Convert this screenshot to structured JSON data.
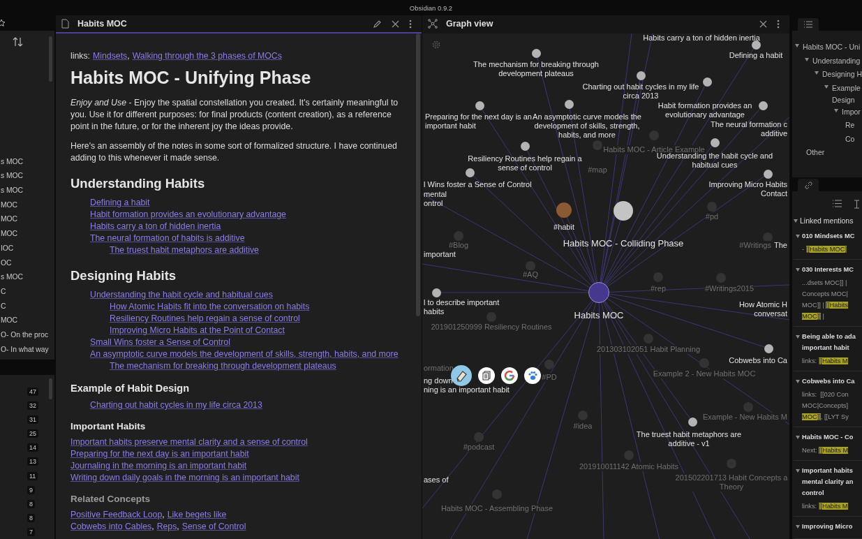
{
  "app_title": "Obsidian 0.9.2",
  "left": {
    "files": [
      "s MOC",
      "s MOC",
      "s MOC",
      "MOC",
      "MOC",
      "MOC",
      "IOC",
      "OC",
      "s MOC",
      "C",
      "C",
      "MOC",
      "O- On the proc",
      "O- In what way"
    ],
    "tag_counts": [
      "47",
      "32",
      "31",
      "25",
      "14",
      "13",
      "11",
      "9",
      "8",
      "8",
      "7"
    ]
  },
  "editor": {
    "tab_title": "Habits MOC",
    "links_label": "links:",
    "links": [
      "Mindsets",
      "Walking through the 3 phases of MOCs"
    ],
    "separator": ",",
    "title": "Habits MOC - Unifying Phase",
    "paragraphs": [
      "*Enjoy and Use* - Enjoy the spatial constellation you created. It's certainly meaningful to you. Use it for different purposes: for final products (content creation), as a reference point in the future, or for the inherent joy the ideas provide.",
      "Here's an assembly of the notes in some sort of formalized structure. I have continued adding to this whenever it made sense."
    ],
    "sections": [
      {
        "heading": "Understanding Habits",
        "kind": "h2",
        "items": [
          {
            "text": "Defining a habit"
          },
          {
            "text": "Habit formation provides an evolutionary advantage"
          },
          {
            "text": "Habits carry a ton of hidden inertia"
          },
          {
            "text": "The neural formation of habits is additive",
            "children": [
              {
                "text": "The truest habit metaphors are additive"
              }
            ]
          }
        ]
      },
      {
        "heading": "Designing Habits",
        "kind": "h2",
        "items": [
          {
            "text": "Understanding the habit cycle and habitual cues",
            "children": [
              {
                "text": "How Atomic Habits fit into the conversation on habits"
              },
              {
                "text": "Resiliency Routines help regain a sense of control"
              },
              {
                "text": "Improving Micro Habits at the Point of Contact"
              }
            ]
          },
          {
            "text": "Small Wins foster a Sense of Control"
          },
          {
            "text": "An asymptotic curve models the development of skills, strength, habits, and more",
            "children": [
              {
                "text": "The mechanism for breaking through development plateaus"
              }
            ]
          }
        ]
      },
      {
        "heading": "Example of Habit Design",
        "kind": "h3",
        "items": [
          {
            "text": "Charting out habit cycles in my life circa 2013"
          }
        ]
      },
      {
        "heading": "Important Habits",
        "kind": "h4",
        "lines": [
          "Important habits preserve mental clarity and a sense of control",
          "Preparing for the next day is an important habit",
          "Journaling in the morning is an important habit",
          "Writing down daily goals in the morning is an important habit"
        ]
      },
      {
        "heading": "Related Concepts",
        "kind": "h4-dim",
        "link_rows": [
          [
            "Positive Feedback Loop",
            "Like begets like"
          ],
          [
            "Cobwebs into Cables",
            "Reps",
            "Sense of Control"
          ]
        ]
      }
    ]
  },
  "graph": {
    "tab_title": "Graph view",
    "nodes": [
      {
        "label": "Habits carry a ton of hidden inertia",
        "kind": "text"
      },
      {
        "label": "Defining a habit",
        "kind": "note"
      },
      {
        "label": "The mechanism for breaking through\ndevelopment plateaus",
        "kind": "note"
      },
      {
        "label": "Charting out habit cycles in my life\ncirca 2013",
        "kind": "note"
      },
      {
        "label": "Habit formation provides an\nevolutionary advantage",
        "kind": "note"
      },
      {
        "label": "Preparing for the next day is an\nimportant habit",
        "kind": "note"
      },
      {
        "label": "An asymptotic curve models the\ndevelopment of skills, strength,\nhabits, and more",
        "kind": "note"
      },
      {
        "label": "The neural formation c\nadditive",
        "kind": "note"
      },
      {
        "label": "Habits MOC - Article Example",
        "kind": "faded"
      },
      {
        "label": "Resiliency Routines help regain a\nsense of control",
        "kind": "note"
      },
      {
        "label": "Understanding the habit cycle and\nhabitual cues",
        "kind": "note"
      },
      {
        "label": "#map",
        "kind": "faded"
      },
      {
        "label": "l Wins foster a Sense of Control",
        "kind": "note"
      },
      {
        "label": "mental\nontrol",
        "kind": "text"
      },
      {
        "label": "Improving Micro Habits\nContact",
        "kind": "note"
      },
      {
        "label": "#pd",
        "kind": "faded"
      },
      {
        "label": "#habit",
        "kind": "tag"
      },
      {
        "label": "#Blog",
        "kind": "faded"
      },
      {
        "label": "Habits MOC - Colliding Phase",
        "kind": "hub"
      },
      {
        "label": "important",
        "kind": "text"
      },
      {
        "label": "#Writings",
        "kind": "faded"
      },
      {
        "label": "The",
        "kind": "text"
      },
      {
        "label": "#AQ",
        "kind": "faded"
      },
      {
        "label": "Habits MOC",
        "kind": "center"
      },
      {
        "label": "l to describe important\nhabits",
        "kind": "note"
      },
      {
        "label": "#rep",
        "kind": "faded"
      },
      {
        "label": "#Writings2015",
        "kind": "faded"
      },
      {
        "label": "How Atomic H\nconversat",
        "kind": "text"
      },
      {
        "label": "201901250999 Resiliency Routines",
        "kind": "faded"
      },
      {
        "label": "201303102051 Habit Planning",
        "kind": "faded"
      },
      {
        "label": "Cobwebs into Ca",
        "kind": "note"
      },
      {
        "label": "Example 2 - New Habits MOC",
        "kind": "faded"
      },
      {
        "label": "ormation",
        "kind": "faded"
      },
      {
        "label": "ng down",
        "kind": "text"
      },
      {
        "label": "ning is an important habit",
        "kind": "text"
      },
      {
        "label": "#PD",
        "kind": "faded"
      },
      {
        "label": "#idea",
        "kind": "faded"
      },
      {
        "label": "The truest habit metaphors are\nadditive - v1",
        "kind": "note"
      },
      {
        "label": "Example - New Habits M",
        "kind": "faded"
      },
      {
        "label": "#podcast",
        "kind": "faded"
      },
      {
        "label": "201910011142 Atomic Habits",
        "kind": "faded"
      },
      {
        "label": "ases of",
        "kind": "text"
      },
      {
        "label": "201502201713 Habit Concepts a\nTheory",
        "kind": "faded"
      },
      {
        "label": "Habits MOC - Assembling Phase",
        "kind": "faded"
      }
    ]
  },
  "outline": [
    {
      "label": "Habits MOC - Uni",
      "expanded": true,
      "children": [
        {
          "label": "Understanding",
          "expanded": true,
          "children": [
            {
              "label": "Designing H",
              "expanded": true,
              "children": [
                {
                  "label": "Example\nDesign",
                  "expanded": true,
                  "children": [
                    {
                      "label": "Impor",
                      "expanded": true,
                      "children": [
                        {
                          "label": "Re"
                        },
                        {
                          "label": "Co"
                        }
                      ]
                    }
                  ]
                }
              ]
            }
          ]
        },
        {
          "label": "Other"
        }
      ]
    }
  ],
  "backlinks": {
    "title": "Linked mentions",
    "expanded": true,
    "groups": [
      {
        "title": "010 Mindsets MC",
        "expanded": true,
        "lines": [
          [
            {
              "text": "- ",
              "highlight": false
            },
            {
              "text": "[[Habits MOC]",
              "highlight": true
            }
          ]
        ]
      },
      {
        "title": "030 Interests MC",
        "expanded": true,
        "lines": [
          [
            {
              "text": "...dsets MOC]] |",
              "highlight": false
            }
          ],
          [
            {
              "text": "Concepts MOC|",
              "highlight": false
            }
          ],
          [
            {
              "text": "MOC]] | ",
              "highlight": false
            },
            {
              "text": "[[Habits",
              "highlight": true
            }
          ],
          [
            {
              "text": "MOC]]",
              "highlight": true
            },
            {
              "text": " |",
              "highlight": false
            }
          ]
        ]
      },
      {
        "title": "Being able to ada\nimportant habit",
        "expanded": true,
        "lines": [
          [
            {
              "text": "links: ",
              "highlight": false
            },
            {
              "text": "[[Habits M",
              "highlight": true
            }
          ]
        ]
      },
      {
        "title": "Cobwebs into Ca",
        "expanded": true,
        "lines": [
          [
            {
              "text": "links:  [[020 Con",
              "highlight": false
            }
          ],
          [
            {
              "text": "MOC|Concepts]",
              "highlight": false
            }
          ],
          [
            {
              "text": "MOC]]",
              "highlight": true
            },
            {
              "text": ", [[LYT Sy",
              "highlight": false
            }
          ]
        ]
      },
      {
        "title": "Habits MOC - Co",
        "expanded": true,
        "lines": [
          [
            {
              "text": "Next: ",
              "highlight": false
            },
            {
              "text": "[[Habits M",
              "highlight": true
            }
          ]
        ]
      },
      {
        "title": "Important habits\nmental clarity an\ncontrol",
        "expanded": true,
        "lines": [
          [
            {
              "text": "links: ",
              "highlight": false
            },
            {
              "text": "[[Habits M",
              "highlight": true
            }
          ]
        ]
      },
      {
        "title": "Improving Micro",
        "expanded": true
      }
    ]
  }
}
